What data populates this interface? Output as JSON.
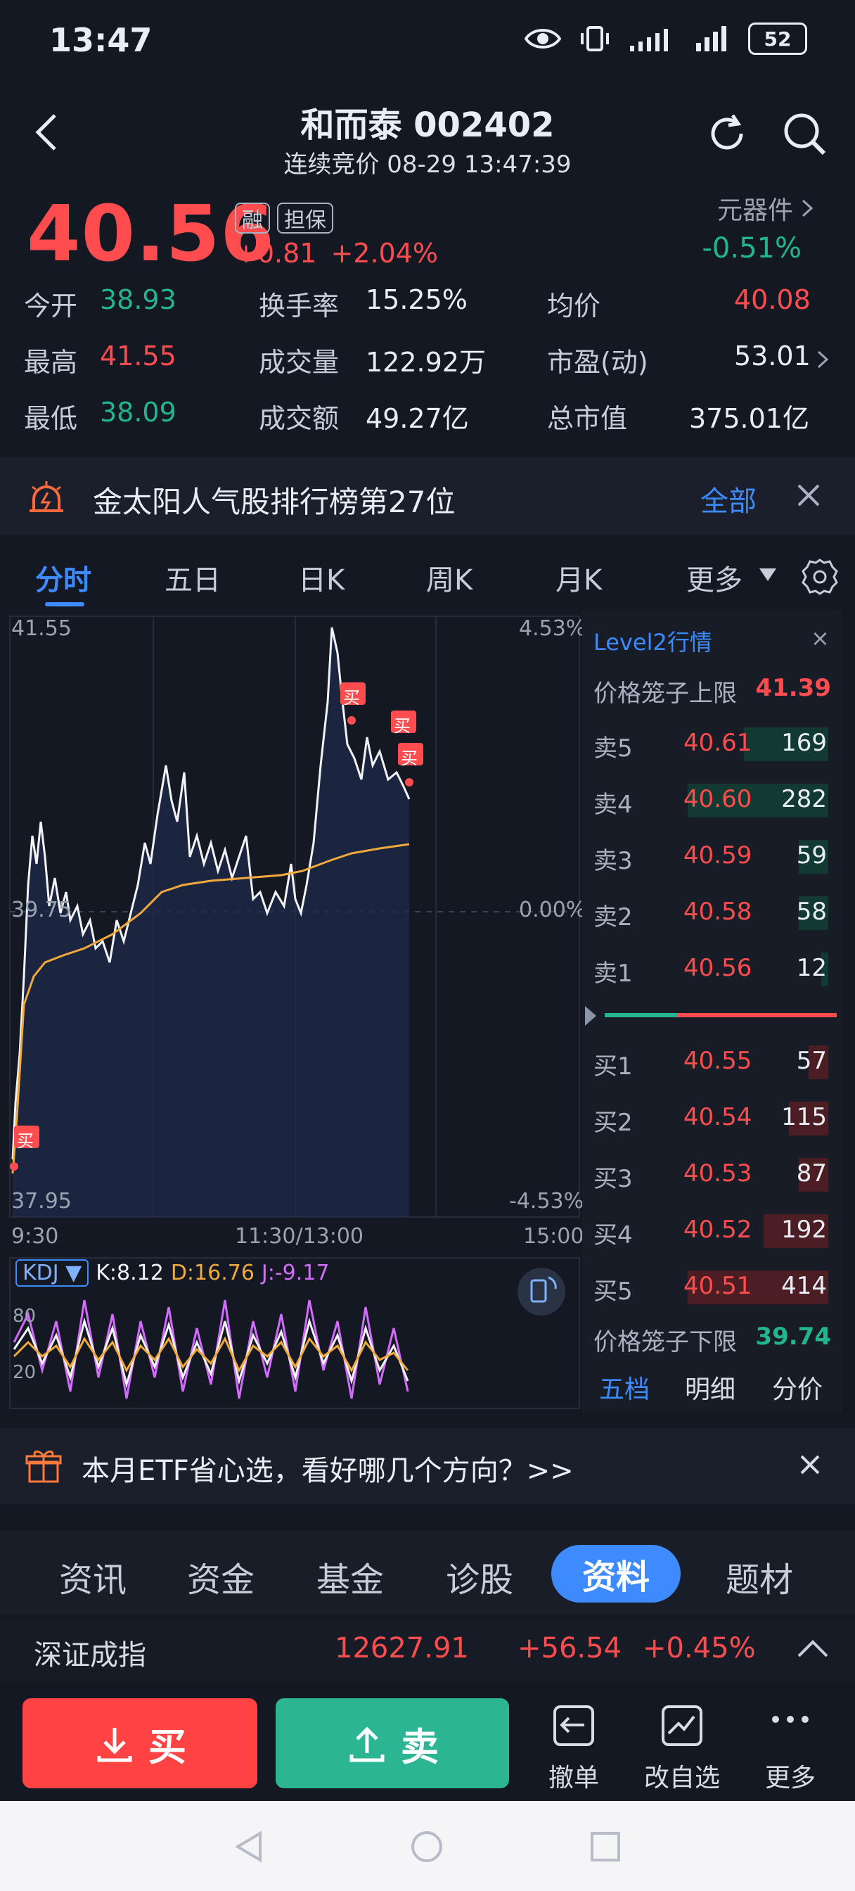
{
  "status": {
    "time": "13:47",
    "battery": "52"
  },
  "header": {
    "title": "和而泰 002402",
    "subtitle": "连续竞价 08-29 13:47:39"
  },
  "price": {
    "last": "40.56",
    "tags": [
      "融",
      "担保"
    ],
    "change": "+0.81",
    "change_pct": "+2.04%",
    "sector": "元器件",
    "sector_change": "-0.51%"
  },
  "quote": [
    {
      "label": "今开",
      "value": "38.93",
      "color": "green"
    },
    {
      "label": "换手率",
      "value": "15.25%",
      "color": "white"
    },
    {
      "label": "均价",
      "value": "40.08",
      "color": "red"
    },
    {
      "label": "最高",
      "value": "41.55",
      "color": "red"
    },
    {
      "label": "成交量",
      "value": "122.92万",
      "color": "white"
    },
    {
      "label": "市盈(动)",
      "value": "53.01",
      "color": "white"
    },
    {
      "label": "最低",
      "value": "38.09",
      "color": "green"
    },
    {
      "label": "成交额",
      "value": "49.27亿",
      "color": "white"
    },
    {
      "label": "总市值",
      "value": "375.01亿",
      "color": "white"
    }
  ],
  "banner": {
    "text": "金太阳人气股排行榜第27位",
    "link": "全部"
  },
  "tabs": [
    "分时",
    "五日",
    "日K",
    "周K",
    "月K",
    "更多"
  ],
  "chart": {
    "y_top": "41.55",
    "y_mid": "39.75",
    "y_bottom": "37.95",
    "pct_top": "4.53%",
    "pct_mid": "0.00%",
    "pct_bottom": "-4.53%",
    "x_labels": [
      "9:30",
      "11:30/13:00",
      "15:00"
    ],
    "buy_marker": "买",
    "kdj": {
      "name": "KDJ",
      "k": "K:8.12",
      "d": "D:16.76",
      "j": "J:-9.17",
      "lv80": "80",
      "lv20": "20"
    }
  },
  "orderbook": {
    "title": "Level2行情",
    "upper_label": "价格笼子上限",
    "upper_value": "41.39",
    "asks": [
      {
        "label": "卖5",
        "price": "40.61",
        "vol": "169",
        "ratio": 0.6
      },
      {
        "label": "卖4",
        "price": "40.60",
        "vol": "282",
        "ratio": 1.0
      },
      {
        "label": "卖3",
        "price": "40.59",
        "vol": "59",
        "ratio": 0.21
      },
      {
        "label": "卖2",
        "price": "40.58",
        "vol": "58",
        "ratio": 0.21
      },
      {
        "label": "卖1",
        "price": "40.56",
        "vol": "12",
        "ratio": 0.05
      }
    ],
    "bids": [
      {
        "label": "买1",
        "price": "40.55",
        "vol": "57",
        "ratio": 0.14
      },
      {
        "label": "买2",
        "price": "40.54",
        "vol": "115",
        "ratio": 0.28
      },
      {
        "label": "买3",
        "price": "40.53",
        "vol": "87",
        "ratio": 0.21
      },
      {
        "label": "买4",
        "price": "40.52",
        "vol": "192",
        "ratio": 0.46
      },
      {
        "label": "买5",
        "price": "40.51",
        "vol": "414",
        "ratio": 1.0
      }
    ],
    "lower_label": "价格笼子下限",
    "lower_value": "39.74",
    "tabs": [
      "五档",
      "明细",
      "分价"
    ]
  },
  "etf": {
    "text": "本月ETF省心选，看好哪几个方向？>>"
  },
  "bottom_tabs": [
    "资讯",
    "资金",
    "基金",
    "诊股",
    "资料",
    "题材"
  ],
  "index": {
    "name": "深证成指",
    "value": "12627.91",
    "change": "+56.54",
    "pct": "+0.45%"
  },
  "actions": {
    "buy": "买",
    "sell": "卖",
    "cancel": "撤单",
    "modify": "改自选",
    "more": "更多"
  }
}
